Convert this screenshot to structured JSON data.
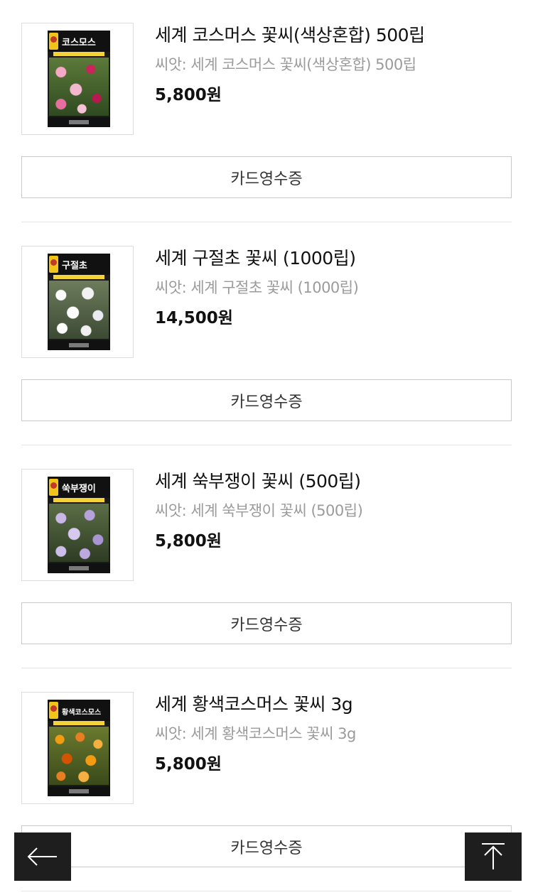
{
  "orders": [
    {
      "title": "세계 코스머스 꽃씨(색상혼합) 500립",
      "option": "씨앗: 세계 코스머스 꽃씨(색상혼합) 500립",
      "price": "5,800원",
      "receipt_label": "카드영수증",
      "packet_label": "코스모스",
      "photo": "pink-cosmos"
    },
    {
      "title": "세계 구절초 꽃씨 (1000립)",
      "option": "씨앗: 세계 구절초 꽃씨 (1000립)",
      "price": "14,500원",
      "receipt_label": "카드영수증",
      "packet_label": "구절초",
      "photo": "white-daisy"
    },
    {
      "title": "세계 쑥부쟁이 꽃씨 (500립)",
      "option": "씨앗: 세계 쑥부쟁이 꽃씨 (500립)",
      "price": "5,800원",
      "receipt_label": "카드영수증",
      "packet_label": "쑥부쟁이",
      "photo": "lilac-aster"
    },
    {
      "title": "세계 황색코스머스 꽃씨 3g",
      "option": "씨앗: 세계 황색코스머스 꽃씨 3g",
      "price": "5,800원",
      "receipt_label": "카드영수증",
      "packet_label": "황색코스모스",
      "photo": "orange-cosmos"
    }
  ],
  "floating": {
    "back_icon": "arrow-left-icon",
    "top_icon": "arrow-up-to-top-icon"
  },
  "colors": {
    "text_primary": "#111111",
    "text_secondary": "#9b9b9b",
    "button_border": "#c9c9c9",
    "floating_bg": "#1e1e1e"
  }
}
